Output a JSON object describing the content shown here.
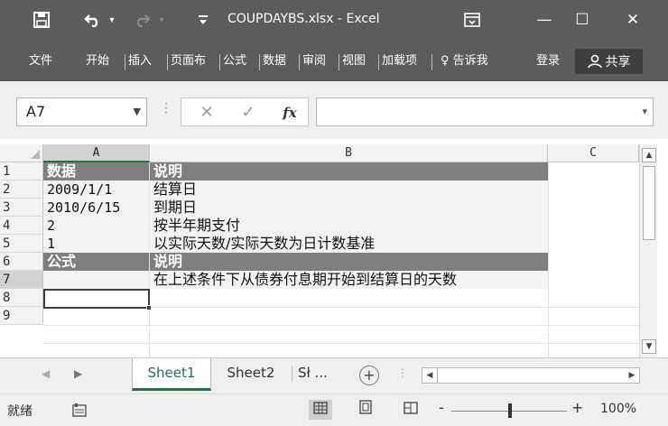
{
  "window": {
    "title": "COUPDAYBS.xlsx - Excel",
    "minimize": "—",
    "maximize": "☐",
    "close": "✕"
  },
  "quick_access": {
    "save": "🖫",
    "undo": "↶",
    "undo_dd": "▾",
    "redo": "↷",
    "redo_dd": "▾",
    "customize": "⩲"
  },
  "ribbon_tabs": [
    "文件",
    "开始",
    "插入",
    "页面布",
    "公式",
    "数据",
    "审阅",
    "视图",
    "加载项"
  ],
  "tell_me": "♀ 告诉我",
  "login": "登录",
  "share": "共享",
  "formula_bar": {
    "name_box": "A7",
    "cancel": "✕",
    "enter": "✓",
    "fx": "fx",
    "value": ""
  },
  "columns": [
    "A",
    "B",
    "C"
  ],
  "rows": [
    {
      "num": "1",
      "a": "数据",
      "b": "说明",
      "style": "header"
    },
    {
      "num": "2",
      "a": "2009/1/1",
      "b": "结算日",
      "style": "data"
    },
    {
      "num": "3",
      "a": "2010/6/15",
      "b": "到期日",
      "style": "data"
    },
    {
      "num": "4",
      "a": "2",
      "b": "按半年期支付",
      "style": "data"
    },
    {
      "num": "5",
      "a": "1",
      "b": "以实际天数/实际天数为日计数基准",
      "style": "data"
    },
    {
      "num": "6",
      "a": "公式",
      "b": "说明",
      "style": "header"
    },
    {
      "num": "7",
      "a": "",
      "b": "在上述条件下从债券付息期开始到结算日的天数",
      "style": "data"
    },
    {
      "num": "8",
      "a": "",
      "b": "",
      "style": "empty"
    },
    {
      "num": "9",
      "a": "",
      "b": "",
      "style": "empty"
    }
  ],
  "sheet_tabs": [
    "Sheet1",
    "Sheet2",
    "Sł ..."
  ],
  "active_sheet": "Sheet1",
  "status": {
    "ready": "就绪",
    "zoom_minus": "-",
    "zoom_plus": "+",
    "zoom": "100%"
  },
  "colors": {
    "title_bg": "#5c5c5c",
    "header_row_bg": "#7f7f7f",
    "accent": "#217346"
  }
}
